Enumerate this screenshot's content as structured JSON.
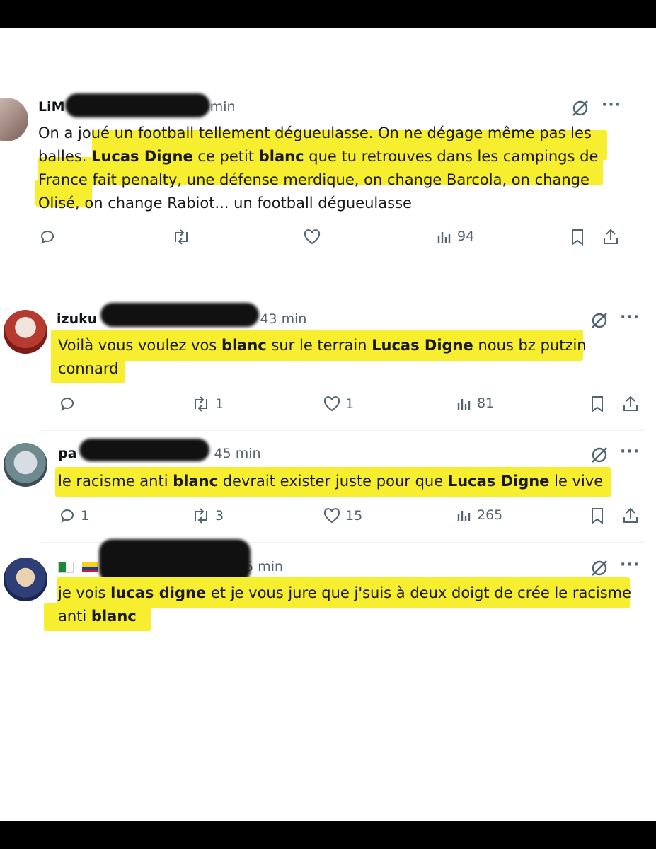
{
  "tweets": [
    {
      "name": "LiM",
      "handle_time": "5 min",
      "text_parts": [
        "On a joué un football tellement dégueulasse. On ne dégage même pas les balles. ",
        "Lucas Digne",
        " ce petit ",
        "blanc",
        " que tu retrouves dans les campings de France fait penalty, une défense merdique, on change Barcola, on change Olisé, on change Rabiot... un football dégueulasse"
      ],
      "reply_count": "",
      "retweet_count": "",
      "like_count": "",
      "view_count": "94"
    },
    {
      "name": "izuku",
      "handle_time": "43 min",
      "text_parts": [
        "Voilà vous voulez vos ",
        "blanc",
        " sur le terrain ",
        "Lucas Digne",
        " nous bz putzin connard"
      ],
      "reply_count": "",
      "retweet_count": "1",
      "like_count": "1",
      "view_count": "81"
    },
    {
      "name": "pa",
      "handle_time": "45 min",
      "text_parts": [
        "le racisme anti ",
        "blanc",
        " devrait exister juste pour que ",
        "Lucas Digne",
        " le vive"
      ],
      "reply_count": "1",
      "retweet_count": "3",
      "like_count": "15",
      "view_count": "265"
    },
    {
      "name": "",
      "handle_time": "5 min",
      "text_parts": [
        "je vois ",
        "lucas digne",
        " et je vous jure que j'suis à deux doigt de crée le racisme anti ",
        "blanc"
      ],
      "reply_count": "",
      "retweet_count": "",
      "like_count": "",
      "view_count": ""
    }
  ],
  "colors": {
    "highlight": "#f7ee2f",
    "muted": "#536471",
    "background": "#ffffff",
    "frame": "#000000"
  }
}
